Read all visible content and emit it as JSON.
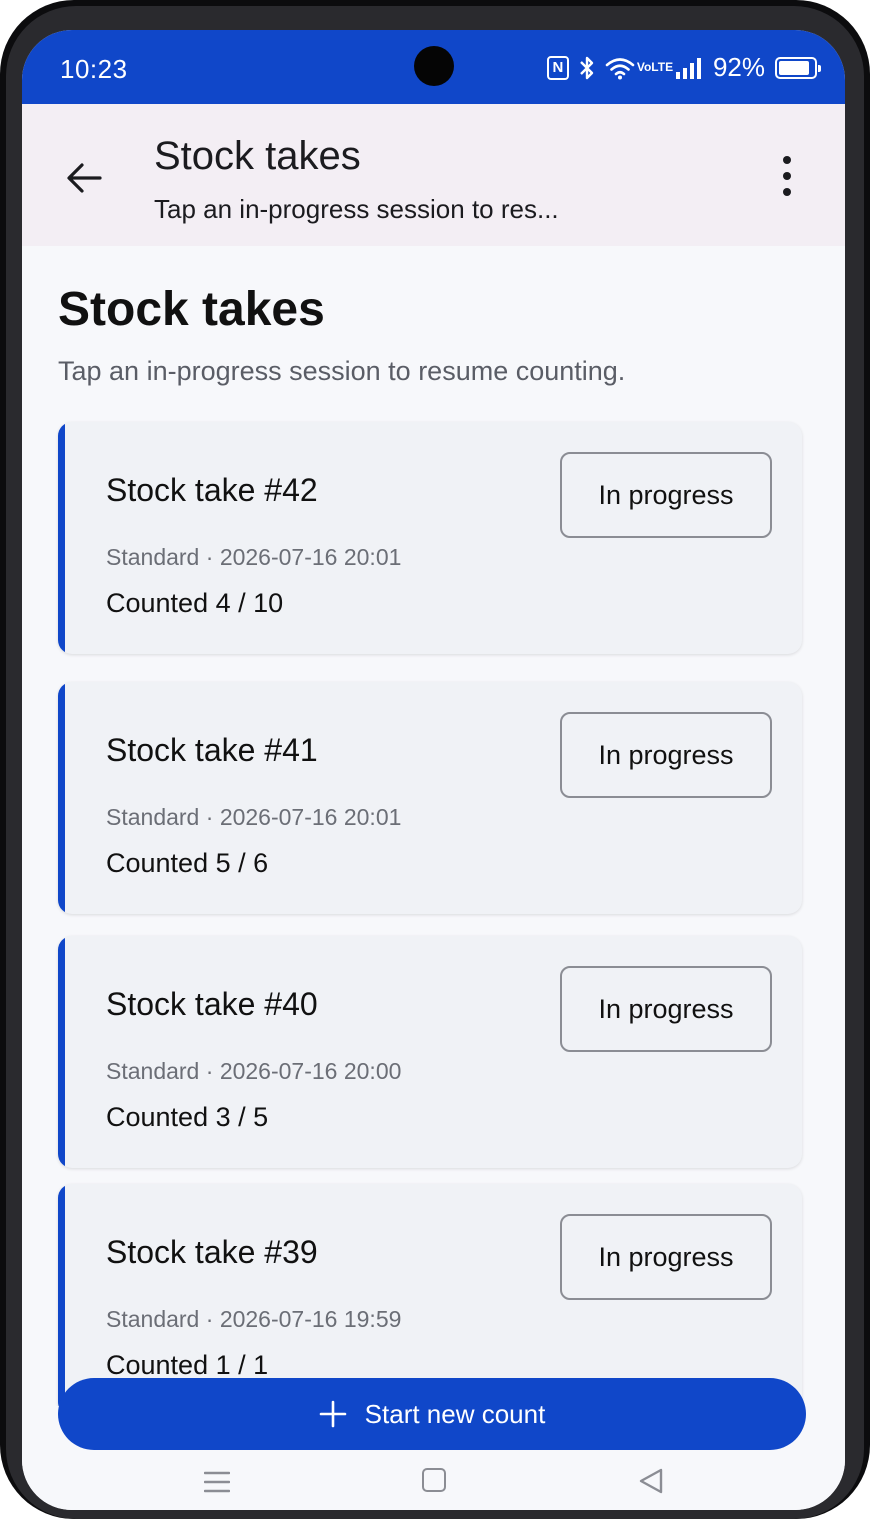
{
  "status_bar": {
    "time": "10:23",
    "battery": "92%",
    "battery_level": 0.92,
    "icons": [
      "nfc-icon",
      "bluetooth-icon",
      "wifi-icon",
      "volte-icon",
      "signal-icon",
      "battery-icon"
    ],
    "volte_top": "Vo",
    "volte_bottom": "LTE"
  },
  "app_bar": {
    "title": "Stock takes",
    "subtitle": "Tap an in-progress session to res...",
    "back_icon": "arrow-left-icon",
    "menu_icon": "more-vert-icon"
  },
  "page": {
    "title": "Stock takes",
    "subtitle": "Tap an in-progress session to resume counting."
  },
  "cards": [
    {
      "title": "Stock take #42",
      "type": "Standard",
      "separator": "·",
      "date": "2026-07-16 20:01",
      "counted": "Counted 4 / 10",
      "status": "In progress"
    },
    {
      "title": "Stock take #41",
      "type": "Standard",
      "separator": "·",
      "date": "2026-07-16 20:01",
      "counted": "Counted 5 / 6",
      "status": "In progress"
    },
    {
      "title": "Stock take #40",
      "type": "Standard",
      "separator": "·",
      "date": "2026-07-16 20:00",
      "counted": "Counted 3 / 5",
      "status": "In progress"
    },
    {
      "title": "Stock take #39",
      "type": "Standard",
      "separator": "·",
      "date": "2026-07-16 19:59",
      "counted": "Counted 1 / 1",
      "status": "In progress"
    }
  ],
  "actions": {
    "start_new_count": "Start new count",
    "start_icon": "plus-icon"
  },
  "colors": {
    "primary": "#1047c9",
    "app_bar_bg": "#f3eef4",
    "card_bg": "#f0f2f6"
  }
}
